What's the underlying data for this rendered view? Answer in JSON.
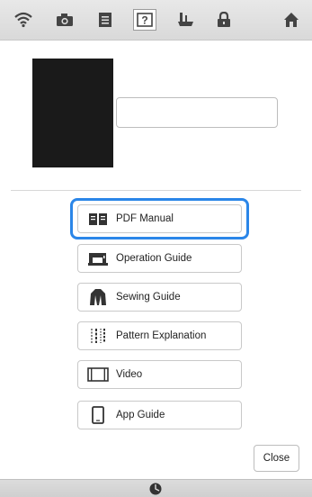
{
  "toolbar": {
    "icons": [
      "wifi-icon",
      "camera-icon",
      "document-icon",
      "help-icon",
      "sewing-foot-icon",
      "lock-icon",
      "home-icon"
    ],
    "active_icon": "help-icon",
    "help_icon_glyph": "?"
  },
  "profile": {
    "name_value": ""
  },
  "menu": {
    "items": [
      {
        "label": "PDF Manual",
        "icon": "book-icon"
      },
      {
        "label": "Operation Guide",
        "icon": "sewing-machine-icon"
      },
      {
        "label": "Sewing Guide",
        "icon": "garment-icon"
      },
      {
        "label": "Pattern Explanation",
        "icon": "stitch-pattern-icon"
      },
      {
        "label": "Video",
        "icon": "film-icon"
      },
      {
        "label": "App Guide",
        "icon": "phone-icon"
      }
    ],
    "selected_index": 0
  },
  "actions": {
    "close_label": "Close"
  },
  "colors": {
    "selection_ring": "#2b86e8",
    "toolbar_bg": "#dedede",
    "thumb_bg": "#1a1a1a"
  }
}
